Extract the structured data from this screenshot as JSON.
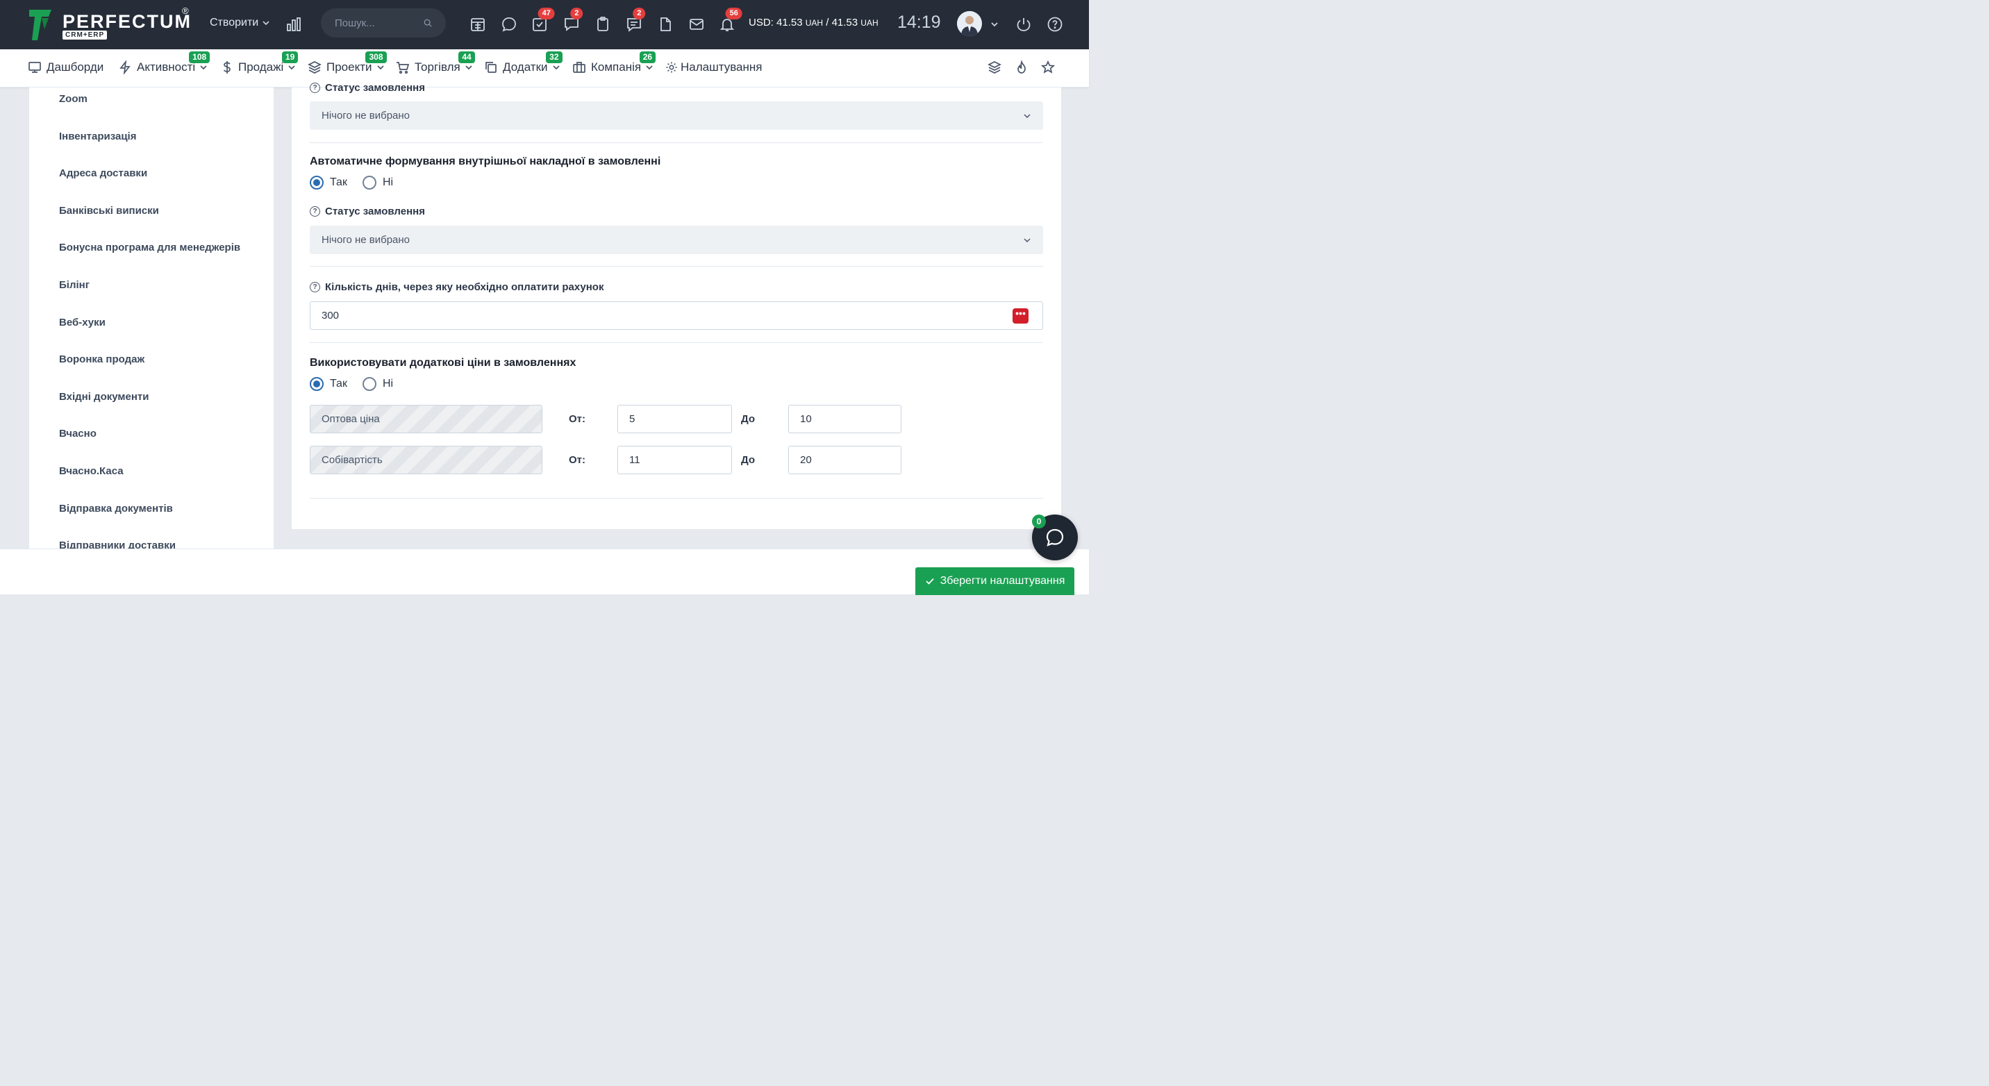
{
  "brand": {
    "name": "PERFECTUM",
    "reg": "®",
    "sub": "CRM+ERP",
    "color": "#1aa053"
  },
  "topbar": {
    "create_label": "Створити",
    "search_placeholder": "Пошук...",
    "badges": {
      "tasks": "47",
      "chats": "2",
      "notes": "2",
      "notifications": "56"
    },
    "currency": {
      "prefix": "USD: 41.53",
      "unit1": "UAH",
      "sep": " / 41.53 ",
      "unit2": "UAH"
    },
    "time": "14:19"
  },
  "menu": {
    "items": [
      {
        "label": "Дашборди",
        "badge": ""
      },
      {
        "label": "Активності",
        "badge": "108"
      },
      {
        "label": "Продажі",
        "badge": "19"
      },
      {
        "label": "Проекти",
        "badge": "308"
      },
      {
        "label": "Торгівля",
        "badge": "44"
      },
      {
        "label": "Додатки",
        "badge": "32"
      },
      {
        "label": "Компанія",
        "badge": "26"
      },
      {
        "label": "Налаштування",
        "badge": ""
      }
    ]
  },
  "sidebar": {
    "items": [
      "Zoom",
      "Інвентаризація",
      "Адреса доставки",
      "Банківські виписки",
      "Бонусна програма для менеджерів",
      "Білінг",
      "Веб-хуки",
      "Воронка продаж",
      "Вхідні документи",
      "Вчасно",
      "Вчасно.Каса",
      "Відправка документів",
      "Відправники доставки"
    ]
  },
  "form": {
    "status_label_top": "Статус замовлення",
    "status_value_top": "Нічого не вибрано",
    "auto_invoice_title": "Автоматичне формування внутрішньої накладної в замовленні",
    "auto_invoice_yes": "Так",
    "auto_invoice_no": "Ні",
    "auto_invoice_selected": "yes",
    "status_label": "Статус замовлення",
    "status_value": "Нічого не вибрано",
    "days_label": "Кількість днів, через яку необхідно оплатити рахунок",
    "days_value": "300",
    "extra_prices_title": "Використовувати додаткові ціни в замовленнях",
    "extra_prices_yes": "Так",
    "extra_prices_no": "Ні",
    "extra_prices_selected": "yes",
    "price_rows": [
      {
        "name": "Оптова ціна",
        "from_label": "От:",
        "from": "5",
        "to_label": "До",
        "to": "10"
      },
      {
        "name": "Собівартість",
        "from_label": "От:",
        "from": "11",
        "to_label": "До",
        "to": "20"
      }
    ]
  },
  "footer": {
    "save_label": "Зберегти налаштування",
    "chat_count": "0"
  }
}
